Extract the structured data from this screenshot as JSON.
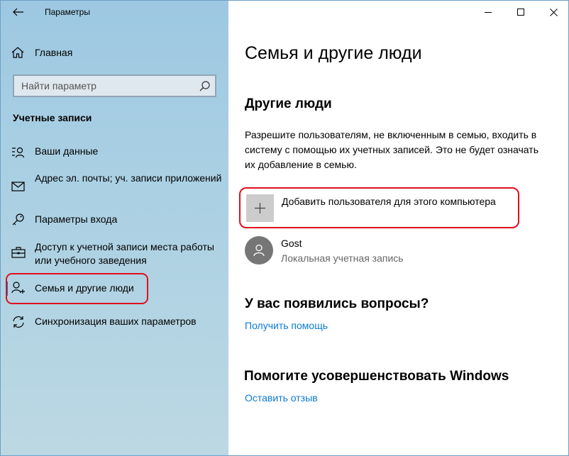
{
  "window": {
    "title": "Параметры",
    "controls": [
      "minimize",
      "maximize",
      "close"
    ]
  },
  "sidebar": {
    "home_label": "Главная",
    "search_placeholder": "Найти параметр",
    "section_title": "Учетные записи",
    "items": [
      {
        "icon": "person-lines-icon",
        "label": "Ваши данные"
      },
      {
        "icon": "mail-icon",
        "label": "Адрес эл. почты; уч. записи приложений"
      },
      {
        "icon": "key-icon",
        "label": "Параметры входа"
      },
      {
        "icon": "briefcase-icon",
        "label": "Доступ к учетной записи места работы или учебного заведения"
      },
      {
        "icon": "add-person-icon",
        "label": "Семья и другие люди",
        "active": true
      },
      {
        "icon": "sync-icon",
        "label": "Синхронизация ваших параметров"
      }
    ]
  },
  "main": {
    "title": "Семья и другие люди",
    "other_people_title": "Другие люди",
    "description": "Разрешите пользователям, не включенным в семью, входить в систему с помощью их учетных записей. Это не будет означать их добавление в семью.",
    "add_user_label": "Добавить пользователя для этого компьютера",
    "user": {
      "name": "Gost",
      "type": "Локальная учетная запись"
    },
    "questions_title": "У вас появились вопросы?",
    "help_link": "Получить помощь",
    "improve_title": "Помогите усовершенствовать Windows",
    "feedback_link": "Оставить отзыв"
  },
  "colors": {
    "accent": "#0078d7",
    "link": "#0a7ad6",
    "highlight": "#e0101e"
  }
}
